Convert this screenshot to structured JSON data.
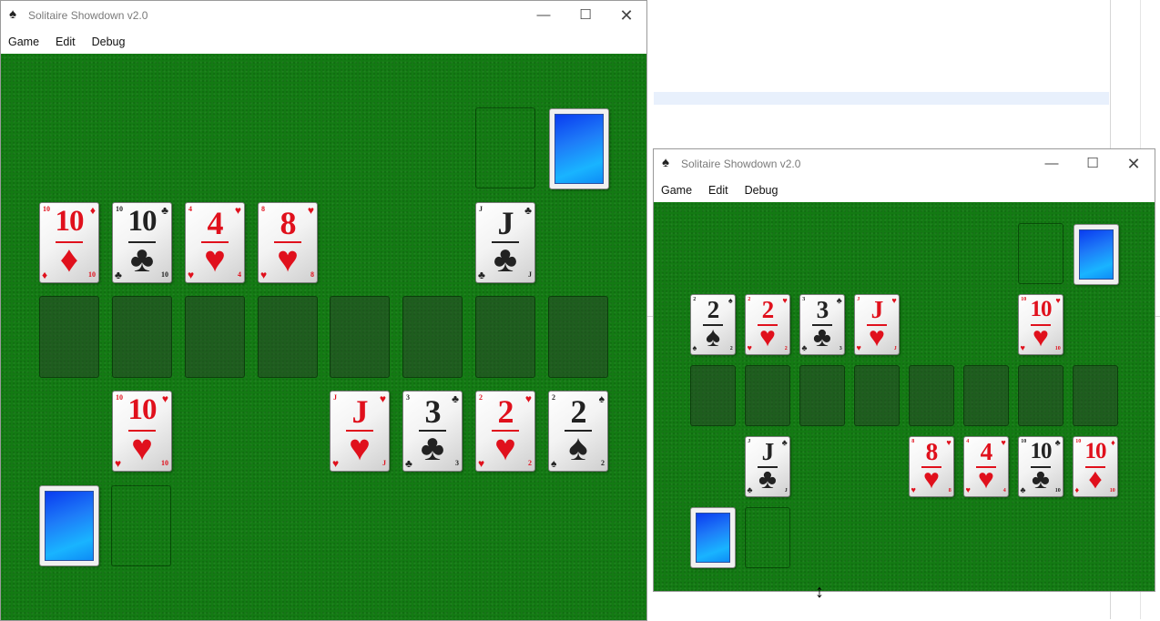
{
  "window_left": {
    "title": "Solitaire Showdown v2.0",
    "menu": [
      "Game",
      "Edit",
      "Debug"
    ],
    "cards": [
      {
        "rank": "10",
        "suit": "♦",
        "color": "red"
      },
      {
        "rank": "10",
        "suit": "♣",
        "color": "black"
      },
      {
        "rank": "4",
        "suit": "♥",
        "color": "red"
      },
      {
        "rank": "8",
        "suit": "♥",
        "color": "red"
      },
      {
        "rank": "J",
        "suit": "♣",
        "color": "black"
      },
      {
        "rank": "10",
        "suit": "♥",
        "color": "red"
      },
      {
        "rank": "J",
        "suit": "♥",
        "color": "red"
      },
      {
        "rank": "3",
        "suit": "♣",
        "color": "black"
      },
      {
        "rank": "2",
        "suit": "♥",
        "color": "red"
      },
      {
        "rank": "2",
        "suit": "♠",
        "color": "black"
      }
    ]
  },
  "window_right": {
    "title": "Solitaire Showdown v2.0",
    "menu": [
      "Game",
      "Edit",
      "Debug"
    ],
    "cards": [
      {
        "rank": "2",
        "suit": "♠",
        "color": "black"
      },
      {
        "rank": "2",
        "suit": "♥",
        "color": "red"
      },
      {
        "rank": "3",
        "suit": "♣",
        "color": "black"
      },
      {
        "rank": "J",
        "suit": "♥",
        "color": "red"
      },
      {
        "rank": "10",
        "suit": "♥",
        "color": "red"
      },
      {
        "rank": "J",
        "suit": "♣",
        "color": "black"
      },
      {
        "rank": "8",
        "suit": "♥",
        "color": "red"
      },
      {
        "rank": "4",
        "suit": "♥",
        "color": "red"
      },
      {
        "rank": "10",
        "suit": "♣",
        "color": "black"
      },
      {
        "rank": "10",
        "suit": "♦",
        "color": "red"
      }
    ]
  },
  "icons": {
    "app": "spade-icon",
    "minimize": "minimize-icon",
    "maximize": "maximize-icon",
    "close": "close-icon",
    "cursor": "resize-vertical-cursor-icon",
    "card_back": "card-back-icon"
  },
  "colors": {
    "felt": "#137a13",
    "card_red": "#e0101c",
    "card_black": "#222222",
    "card_back_blue": "#1e7cf8"
  }
}
